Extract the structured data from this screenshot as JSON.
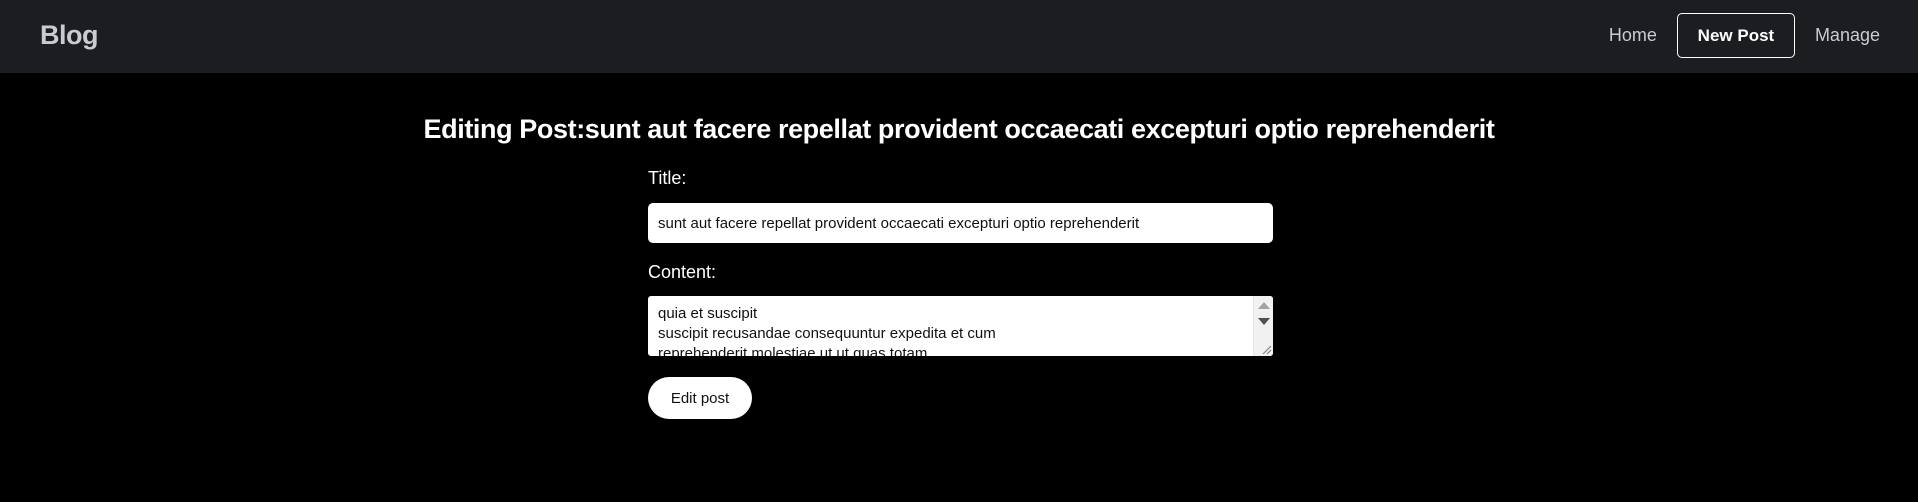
{
  "navbar": {
    "brand": "Blog",
    "links": [
      {
        "label": "Home",
        "active": false
      },
      {
        "label": "New Post",
        "active": true
      },
      {
        "label": "Manage",
        "active": false
      }
    ]
  },
  "page": {
    "heading": "Editing Post:sunt aut facere repellat provident occaecati excepturi optio reprehenderit"
  },
  "form": {
    "title_label": "Title:",
    "title_value": "sunt aut facere repellat provident occaecati excepturi optio reprehenderit",
    "content_label": "Content:",
    "content_value": "quia et suscipit\nsuscipit recusandae consequuntur expedita et cum\nreprehenderit molestiae ut ut quas totam",
    "submit_label": "Edit post"
  },
  "colors": {
    "navbar_bg": "#1c1d21",
    "page_bg": "#000000",
    "text": "#ffffff",
    "nav_text": "#c9cbcf"
  }
}
